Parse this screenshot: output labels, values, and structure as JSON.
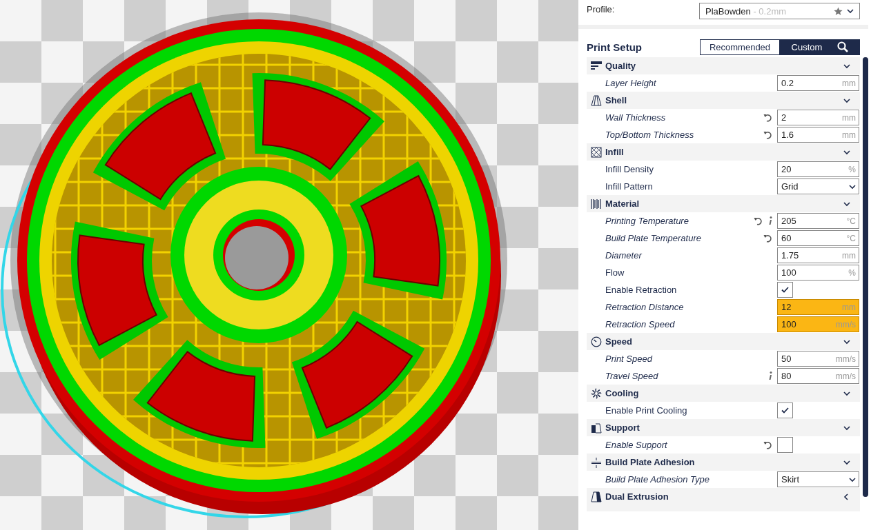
{
  "profile": {
    "label": "Profile:",
    "name": "PlaBowden",
    "detail": "- 0.2mm"
  },
  "print_setup": {
    "title": "Print Setup",
    "tabs": [
      {
        "label": "Recommended",
        "selected": false
      },
      {
        "label": "Custom",
        "selected": true
      }
    ]
  },
  "sections": [
    {
      "title": "Quality",
      "expanded": true,
      "settings": [
        {
          "label": "Layer Height",
          "kind": "number",
          "modified": true,
          "value": "0.2",
          "unit": "mm",
          "resettable": false,
          "info": false,
          "warning": false
        }
      ]
    },
    {
      "title": "Shell",
      "expanded": true,
      "settings": [
        {
          "label": "Wall Thickness",
          "kind": "number",
          "modified": true,
          "value": "2",
          "unit": "mm",
          "resettable": true,
          "info": false,
          "warning": false
        },
        {
          "label": "Top/Bottom Thickness",
          "kind": "number",
          "modified": true,
          "value": "1.6",
          "unit": "mm",
          "resettable": true,
          "info": false,
          "warning": false
        }
      ]
    },
    {
      "title": "Infill",
      "expanded": true,
      "settings": [
        {
          "label": "Infill Density",
          "kind": "number",
          "modified": false,
          "value": "20",
          "unit": "%",
          "resettable": false,
          "info": false,
          "warning": false
        },
        {
          "label": "Infill Pattern",
          "kind": "dropdown",
          "modified": false,
          "value": "Grid",
          "resettable": false,
          "info": false,
          "warning": false
        }
      ]
    },
    {
      "title": "Material",
      "expanded": true,
      "settings": [
        {
          "label": "Printing Temperature",
          "kind": "number",
          "modified": true,
          "value": "205",
          "unit": "°C",
          "resettable": true,
          "info": true,
          "warning": false
        },
        {
          "label": "Build Plate Temperature",
          "kind": "number",
          "modified": true,
          "value": "60",
          "unit": "°C",
          "resettable": true,
          "info": false,
          "warning": false
        },
        {
          "label": "Diameter",
          "kind": "number",
          "modified": true,
          "value": "1.75",
          "unit": "mm",
          "resettable": false,
          "info": false,
          "warning": false
        },
        {
          "label": "Flow",
          "kind": "number",
          "modified": false,
          "value": "100",
          "unit": "%",
          "resettable": false,
          "info": false,
          "warning": false
        },
        {
          "label": "Enable Retraction",
          "kind": "checkbox",
          "modified": false,
          "checked": true,
          "resettable": false,
          "info": false
        },
        {
          "label": "Retraction Distance",
          "kind": "number",
          "modified": true,
          "value": "12",
          "unit": "mm",
          "resettable": false,
          "info": false,
          "warning": true
        },
        {
          "label": "Retraction Speed",
          "kind": "number",
          "modified": true,
          "value": "100",
          "unit": "mm/s",
          "resettable": false,
          "info": false,
          "warning": true
        }
      ]
    },
    {
      "title": "Speed",
      "expanded": true,
      "settings": [
        {
          "label": "Print Speed",
          "kind": "number",
          "modified": true,
          "value": "50",
          "unit": "mm/s",
          "resettable": false,
          "info": false,
          "warning": false
        },
        {
          "label": "Travel Speed",
          "kind": "number",
          "modified": true,
          "value": "80",
          "unit": "mm/s",
          "resettable": false,
          "info": true,
          "warning": false
        }
      ]
    },
    {
      "title": "Cooling",
      "expanded": true,
      "settings": [
        {
          "label": "Enable Print Cooling",
          "kind": "checkbox",
          "modified": false,
          "checked": true,
          "resettable": false,
          "info": false
        }
      ]
    },
    {
      "title": "Support",
      "expanded": true,
      "settings": [
        {
          "label": "Enable Support",
          "kind": "checkbox",
          "modified": true,
          "checked": false,
          "resettable": true,
          "info": false
        }
      ]
    },
    {
      "title": "Build Plate Adhesion",
      "expanded": true,
      "settings": [
        {
          "label": "Build Plate Adhesion Type",
          "kind": "dropdown",
          "modified": true,
          "value": "Skirt",
          "resettable": false,
          "info": false,
          "warning": false
        }
      ]
    },
    {
      "title": "Dual Extrusion",
      "expanded": false
    }
  ]
}
